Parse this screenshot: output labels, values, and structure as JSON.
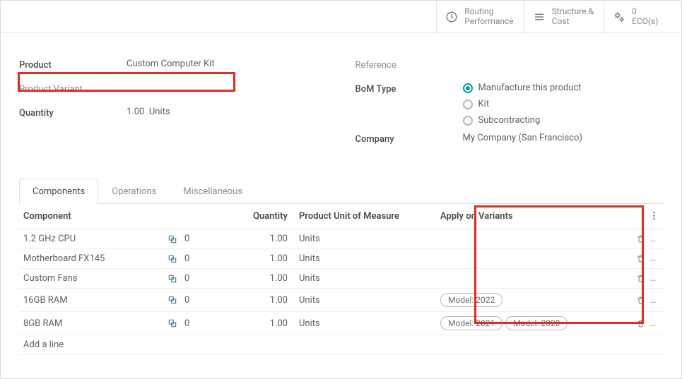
{
  "header": {
    "routing_top": "Routing",
    "routing_bot": "Performance",
    "structure_top": "Structure &",
    "structure_bot": "Cost",
    "eco_top": "0",
    "eco_bot": "ECO(s)"
  },
  "form": {
    "product_label": "Product",
    "product_value": "Custom Computer Kit",
    "variant_label": "Product Variant",
    "variant_value": "",
    "quantity_label": "Quantity",
    "quantity_value": "1.00",
    "quantity_unit": "Units",
    "reference_label": "Reference",
    "bom_type_label": "BoM Type",
    "bom_opt_manufacture": "Manufacture this product",
    "bom_opt_kit": "Kit",
    "bom_opt_subcontract": "Subcontracting",
    "company_label": "Company",
    "company_value": "My Company (San Francisco)"
  },
  "tabs": {
    "components": "Components",
    "operations": "Operations",
    "misc": "Miscellaneous"
  },
  "table": {
    "col_component": "Component",
    "col_quantity": "Quantity",
    "col_uom": "Product Unit of Measure",
    "col_variants": "Apply on Variants",
    "add_line": "Add a line",
    "rows": [
      {
        "name": "1.2 GHz CPU",
        "zero": "0",
        "qty": "1.00",
        "uom": "Units",
        "variants": []
      },
      {
        "name": "Motherboard FX145",
        "zero": "0",
        "qty": "1.00",
        "uom": "Units",
        "variants": []
      },
      {
        "name": "Custom Fans",
        "zero": "0",
        "qty": "1.00",
        "uom": "Units",
        "variants": []
      },
      {
        "name": "16GB RAM",
        "zero": "0",
        "qty": "1.00",
        "uom": "Units",
        "variants": [
          "Model: 2022"
        ]
      },
      {
        "name": "8GB RAM",
        "zero": "0",
        "qty": "1.00",
        "uom": "Units",
        "variants": [
          "Model: 2021",
          "Model: 2020"
        ]
      }
    ]
  }
}
